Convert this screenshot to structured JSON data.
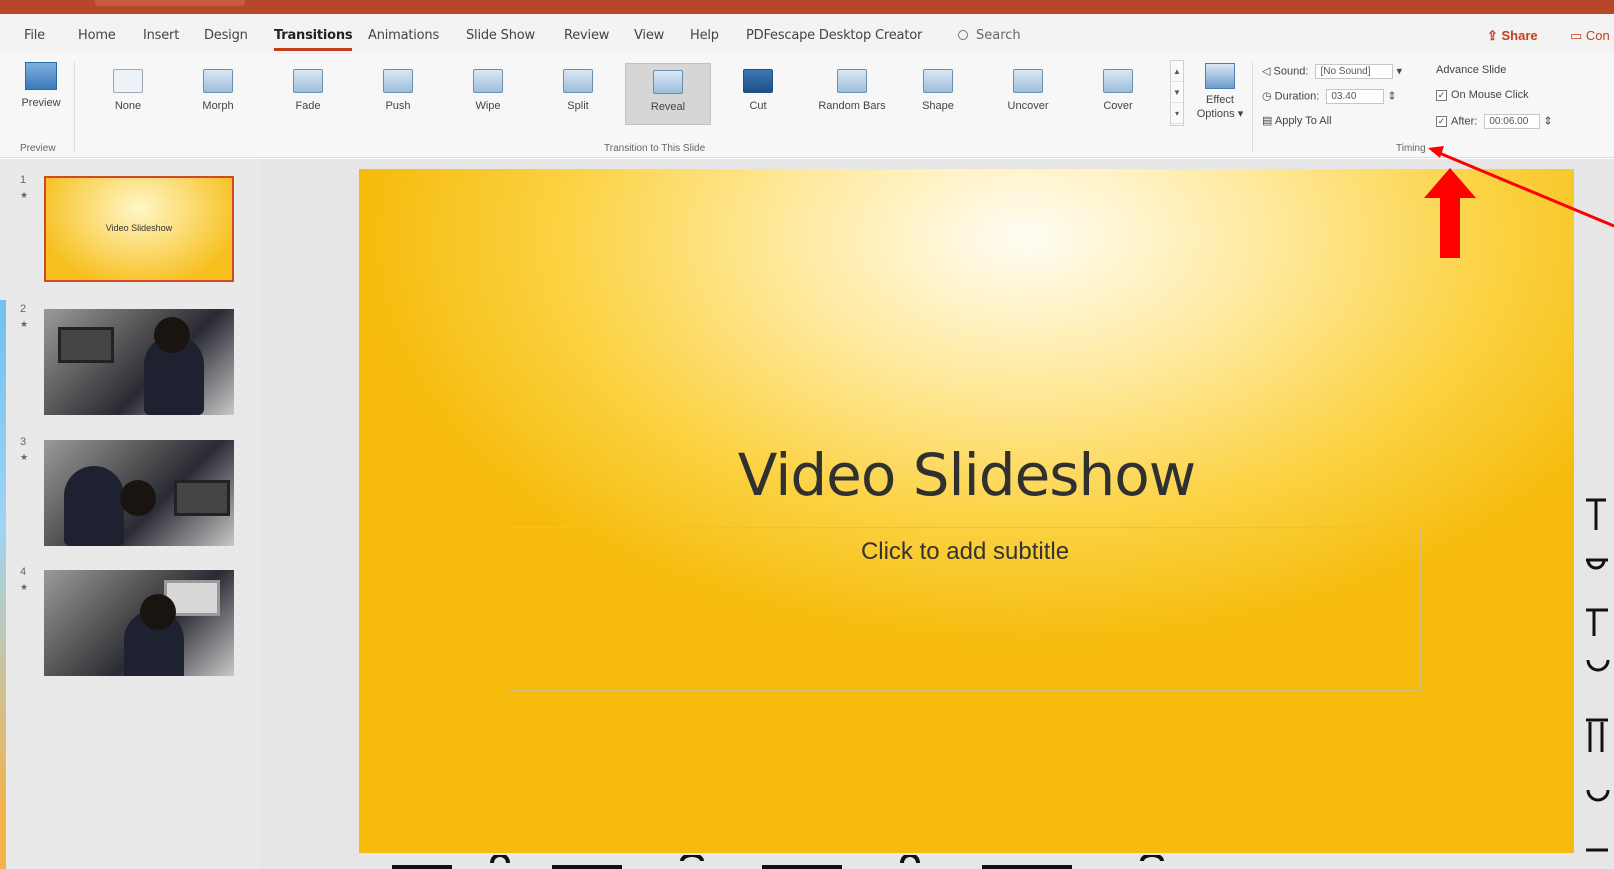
{
  "menubar": {
    "items": [
      {
        "label": "File",
        "active": false
      },
      {
        "label": "Home",
        "active": false
      },
      {
        "label": "Insert",
        "active": false
      },
      {
        "label": "Design",
        "active": false
      },
      {
        "label": "Transitions",
        "active": true
      },
      {
        "label": "Animations",
        "active": false
      },
      {
        "label": "Slide Show",
        "active": false
      },
      {
        "label": "Review",
        "active": false
      },
      {
        "label": "View",
        "active": false
      },
      {
        "label": "Help",
        "active": false
      },
      {
        "label": "PDFescape Desktop Creator",
        "active": false
      }
    ],
    "search_label": "Search",
    "share_label": "Share",
    "comments_label": "Con"
  },
  "ribbon": {
    "preview_label": "Preview",
    "preview_group": "Preview",
    "transitions_group": "Transition to This Slide",
    "transitions": [
      {
        "label": "None",
        "selected": false,
        "icon": "none-transition-icon"
      },
      {
        "label": "Morph",
        "selected": false,
        "icon": "morph-transition-icon"
      },
      {
        "label": "Fade",
        "selected": false,
        "icon": "fade-transition-icon"
      },
      {
        "label": "Push",
        "selected": false,
        "icon": "push-transition-icon"
      },
      {
        "label": "Wipe",
        "selected": false,
        "icon": "wipe-transition-icon"
      },
      {
        "label": "Split",
        "selected": false,
        "icon": "split-transition-icon"
      },
      {
        "label": "Reveal",
        "selected": true,
        "icon": "reveal-transition-icon"
      },
      {
        "label": "Cut",
        "selected": false,
        "icon": "cut-transition-icon"
      },
      {
        "label": "Random Bars",
        "selected": false,
        "icon": "random-bars-transition-icon"
      },
      {
        "label": "Shape",
        "selected": false,
        "icon": "shape-transition-icon"
      },
      {
        "label": "Uncover",
        "selected": false,
        "icon": "uncover-transition-icon"
      },
      {
        "label": "Cover",
        "selected": false,
        "icon": "cover-transition-icon"
      }
    ],
    "effect_options_line1": "Effect",
    "effect_options_line2": "Options",
    "timing": {
      "sound_label": "Sound:",
      "sound_value": "[No Sound]",
      "duration_label": "Duration:",
      "duration_value": "03.40",
      "apply_all_label": "Apply To All",
      "advance_label": "Advance Slide",
      "on_mouse_click_label": "On Mouse Click",
      "on_mouse_click_checked": true,
      "after_label": "After:",
      "after_checked": true,
      "after_value": "00:06.00",
      "group_label": "Timing"
    }
  },
  "slides_pane": {
    "slides": [
      {
        "number": "1",
        "caption": "Video Slideshow",
        "selected": true
      },
      {
        "number": "2",
        "caption": "",
        "selected": false
      },
      {
        "number": "3",
        "caption": "",
        "selected": false
      },
      {
        "number": "4",
        "caption": "",
        "selected": false
      }
    ]
  },
  "slide": {
    "title": "Video Slideshow",
    "subtitle_placeholder": "Click to add subtitle"
  },
  "colors": {
    "accent": "#b7472a",
    "annotation": "#ff0000"
  }
}
